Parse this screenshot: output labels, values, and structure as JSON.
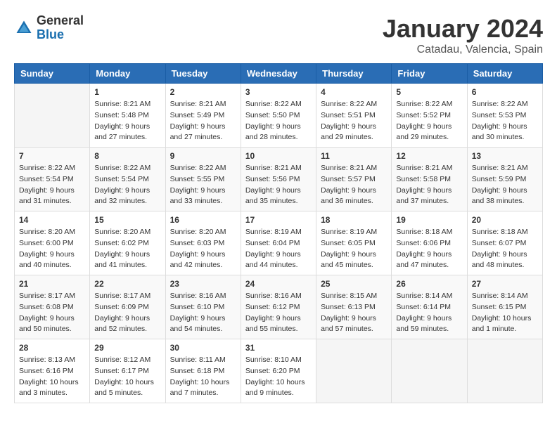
{
  "header": {
    "logo_general": "General",
    "logo_blue": "Blue",
    "month_title": "January 2024",
    "location": "Catadau, Valencia, Spain"
  },
  "weekdays": [
    "Sunday",
    "Monday",
    "Tuesday",
    "Wednesday",
    "Thursday",
    "Friday",
    "Saturday"
  ],
  "weeks": [
    [
      {
        "day": "",
        "sunrise": "",
        "sunset": "",
        "daylight": ""
      },
      {
        "day": "1",
        "sunrise": "Sunrise: 8:21 AM",
        "sunset": "Sunset: 5:48 PM",
        "daylight": "Daylight: 9 hours and 27 minutes."
      },
      {
        "day": "2",
        "sunrise": "Sunrise: 8:21 AM",
        "sunset": "Sunset: 5:49 PM",
        "daylight": "Daylight: 9 hours and 27 minutes."
      },
      {
        "day": "3",
        "sunrise": "Sunrise: 8:22 AM",
        "sunset": "Sunset: 5:50 PM",
        "daylight": "Daylight: 9 hours and 28 minutes."
      },
      {
        "day": "4",
        "sunrise": "Sunrise: 8:22 AM",
        "sunset": "Sunset: 5:51 PM",
        "daylight": "Daylight: 9 hours and 29 minutes."
      },
      {
        "day": "5",
        "sunrise": "Sunrise: 8:22 AM",
        "sunset": "Sunset: 5:52 PM",
        "daylight": "Daylight: 9 hours and 29 minutes."
      },
      {
        "day": "6",
        "sunrise": "Sunrise: 8:22 AM",
        "sunset": "Sunset: 5:53 PM",
        "daylight": "Daylight: 9 hours and 30 minutes."
      }
    ],
    [
      {
        "day": "7",
        "sunrise": "Sunrise: 8:22 AM",
        "sunset": "Sunset: 5:54 PM",
        "daylight": "Daylight: 9 hours and 31 minutes."
      },
      {
        "day": "8",
        "sunrise": "Sunrise: 8:22 AM",
        "sunset": "Sunset: 5:54 PM",
        "daylight": "Daylight: 9 hours and 32 minutes."
      },
      {
        "day": "9",
        "sunrise": "Sunrise: 8:22 AM",
        "sunset": "Sunset: 5:55 PM",
        "daylight": "Daylight: 9 hours and 33 minutes."
      },
      {
        "day": "10",
        "sunrise": "Sunrise: 8:21 AM",
        "sunset": "Sunset: 5:56 PM",
        "daylight": "Daylight: 9 hours and 35 minutes."
      },
      {
        "day": "11",
        "sunrise": "Sunrise: 8:21 AM",
        "sunset": "Sunset: 5:57 PM",
        "daylight": "Daylight: 9 hours and 36 minutes."
      },
      {
        "day": "12",
        "sunrise": "Sunrise: 8:21 AM",
        "sunset": "Sunset: 5:58 PM",
        "daylight": "Daylight: 9 hours and 37 minutes."
      },
      {
        "day": "13",
        "sunrise": "Sunrise: 8:21 AM",
        "sunset": "Sunset: 5:59 PM",
        "daylight": "Daylight: 9 hours and 38 minutes."
      }
    ],
    [
      {
        "day": "14",
        "sunrise": "Sunrise: 8:20 AM",
        "sunset": "Sunset: 6:00 PM",
        "daylight": "Daylight: 9 hours and 40 minutes."
      },
      {
        "day": "15",
        "sunrise": "Sunrise: 8:20 AM",
        "sunset": "Sunset: 6:02 PM",
        "daylight": "Daylight: 9 hours and 41 minutes."
      },
      {
        "day": "16",
        "sunrise": "Sunrise: 8:20 AM",
        "sunset": "Sunset: 6:03 PM",
        "daylight": "Daylight: 9 hours and 42 minutes."
      },
      {
        "day": "17",
        "sunrise": "Sunrise: 8:19 AM",
        "sunset": "Sunset: 6:04 PM",
        "daylight": "Daylight: 9 hours and 44 minutes."
      },
      {
        "day": "18",
        "sunrise": "Sunrise: 8:19 AM",
        "sunset": "Sunset: 6:05 PM",
        "daylight": "Daylight: 9 hours and 45 minutes."
      },
      {
        "day": "19",
        "sunrise": "Sunrise: 8:18 AM",
        "sunset": "Sunset: 6:06 PM",
        "daylight": "Daylight: 9 hours and 47 minutes."
      },
      {
        "day": "20",
        "sunrise": "Sunrise: 8:18 AM",
        "sunset": "Sunset: 6:07 PM",
        "daylight": "Daylight: 9 hours and 48 minutes."
      }
    ],
    [
      {
        "day": "21",
        "sunrise": "Sunrise: 8:17 AM",
        "sunset": "Sunset: 6:08 PM",
        "daylight": "Daylight: 9 hours and 50 minutes."
      },
      {
        "day": "22",
        "sunrise": "Sunrise: 8:17 AM",
        "sunset": "Sunset: 6:09 PM",
        "daylight": "Daylight: 9 hours and 52 minutes."
      },
      {
        "day": "23",
        "sunrise": "Sunrise: 8:16 AM",
        "sunset": "Sunset: 6:10 PM",
        "daylight": "Daylight: 9 hours and 54 minutes."
      },
      {
        "day": "24",
        "sunrise": "Sunrise: 8:16 AM",
        "sunset": "Sunset: 6:12 PM",
        "daylight": "Daylight: 9 hours and 55 minutes."
      },
      {
        "day": "25",
        "sunrise": "Sunrise: 8:15 AM",
        "sunset": "Sunset: 6:13 PM",
        "daylight": "Daylight: 9 hours and 57 minutes."
      },
      {
        "day": "26",
        "sunrise": "Sunrise: 8:14 AM",
        "sunset": "Sunset: 6:14 PM",
        "daylight": "Daylight: 9 hours and 59 minutes."
      },
      {
        "day": "27",
        "sunrise": "Sunrise: 8:14 AM",
        "sunset": "Sunset: 6:15 PM",
        "daylight": "Daylight: 10 hours and 1 minute."
      }
    ],
    [
      {
        "day": "28",
        "sunrise": "Sunrise: 8:13 AM",
        "sunset": "Sunset: 6:16 PM",
        "daylight": "Daylight: 10 hours and 3 minutes."
      },
      {
        "day": "29",
        "sunrise": "Sunrise: 8:12 AM",
        "sunset": "Sunset: 6:17 PM",
        "daylight": "Daylight: 10 hours and 5 minutes."
      },
      {
        "day": "30",
        "sunrise": "Sunrise: 8:11 AM",
        "sunset": "Sunset: 6:18 PM",
        "daylight": "Daylight: 10 hours and 7 minutes."
      },
      {
        "day": "31",
        "sunrise": "Sunrise: 8:10 AM",
        "sunset": "Sunset: 6:20 PM",
        "daylight": "Daylight: 10 hours and 9 minutes."
      },
      {
        "day": "",
        "sunrise": "",
        "sunset": "",
        "daylight": ""
      },
      {
        "day": "",
        "sunrise": "",
        "sunset": "",
        "daylight": ""
      },
      {
        "day": "",
        "sunrise": "",
        "sunset": "",
        "daylight": ""
      }
    ]
  ]
}
